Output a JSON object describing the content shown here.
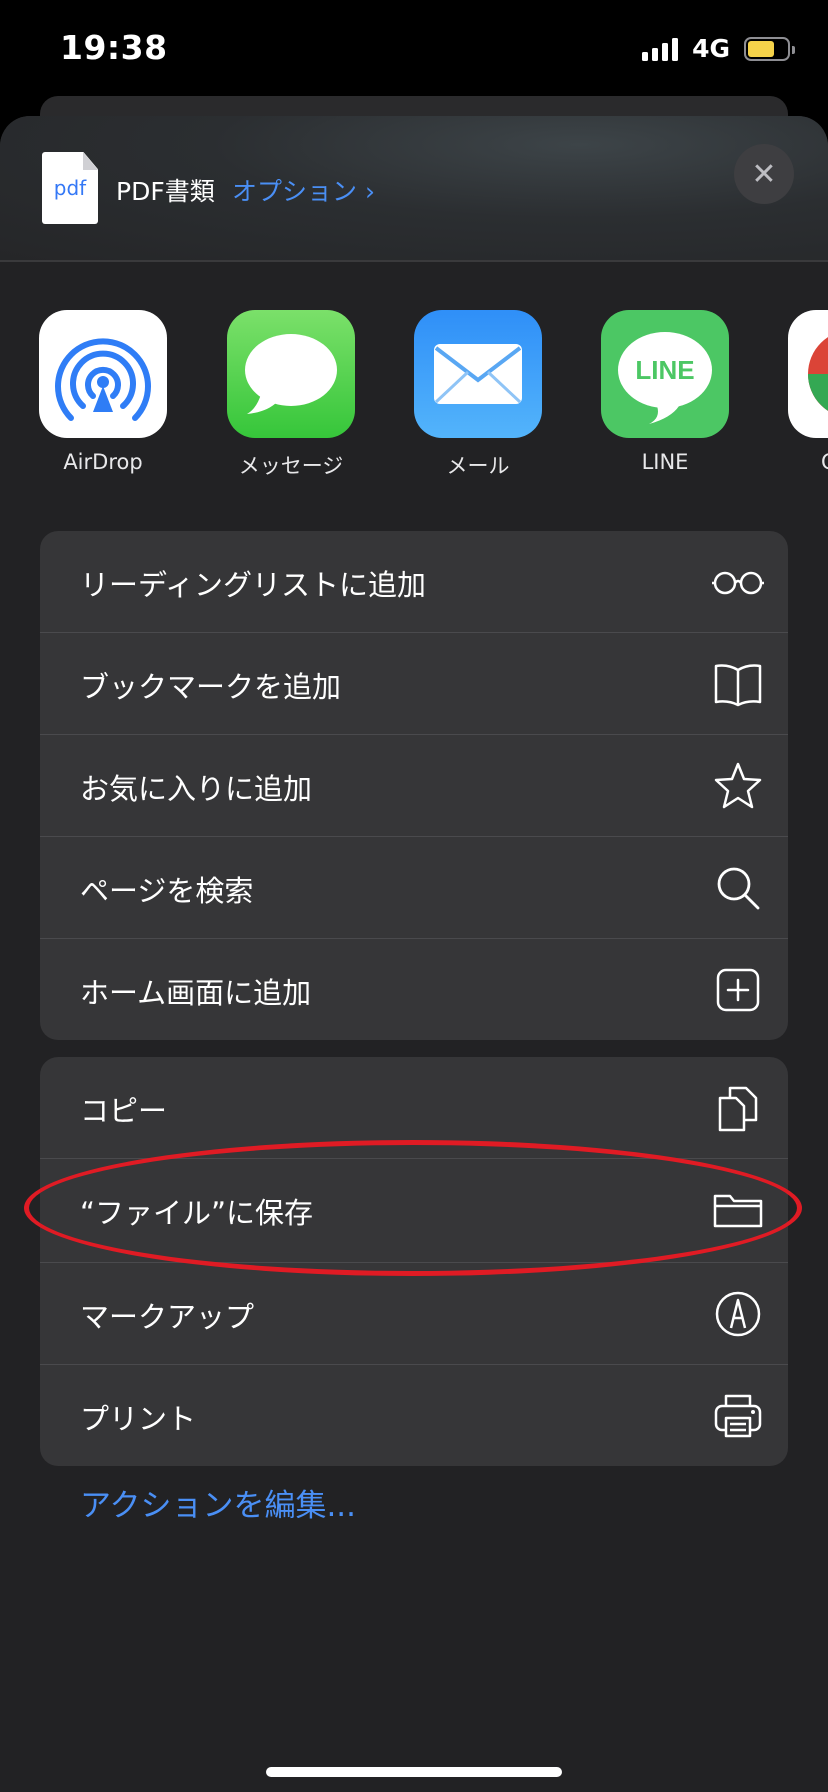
{
  "status_bar": {
    "time": "19:38",
    "network": "4G",
    "battery_color": "#f6d34a"
  },
  "header": {
    "file_icon_text": "pdf",
    "title": "PDF書類",
    "options_label": "オプション ›",
    "close_icon": "close-icon"
  },
  "apps": [
    {
      "label": "AirDrop",
      "icon": "airdrop-icon"
    },
    {
      "label": "メッセージ",
      "icon": "messages-icon"
    },
    {
      "label": "メール",
      "icon": "mail-icon"
    },
    {
      "label": "LINE",
      "icon": "line-icon",
      "icon_text": "LINE"
    },
    {
      "label": "C",
      "icon": "chrome-icon"
    }
  ],
  "actions_group1": [
    {
      "label": "リーディングリストに追加",
      "icon": "glasses-icon"
    },
    {
      "label": "ブックマークを追加",
      "icon": "book-icon"
    },
    {
      "label": "お気に入りに追加",
      "icon": "star-icon"
    },
    {
      "label": "ページを検索",
      "icon": "search-icon"
    },
    {
      "label": "ホーム画面に追加",
      "icon": "add-square-icon"
    }
  ],
  "actions_group2": [
    {
      "label": "コピー",
      "icon": "copy-icon"
    },
    {
      "label": "“ファイル”に保存",
      "icon": "folder-icon"
    },
    {
      "label": "マークアップ",
      "icon": "markup-icon"
    },
    {
      "label": "プリント",
      "icon": "printer-icon"
    }
  ],
  "edit_actions_label": "アクションを編集...",
  "colors": {
    "accent": "#4a8ff5",
    "highlight": "#e01b24",
    "sheet": "#222224",
    "group": "#363638"
  }
}
